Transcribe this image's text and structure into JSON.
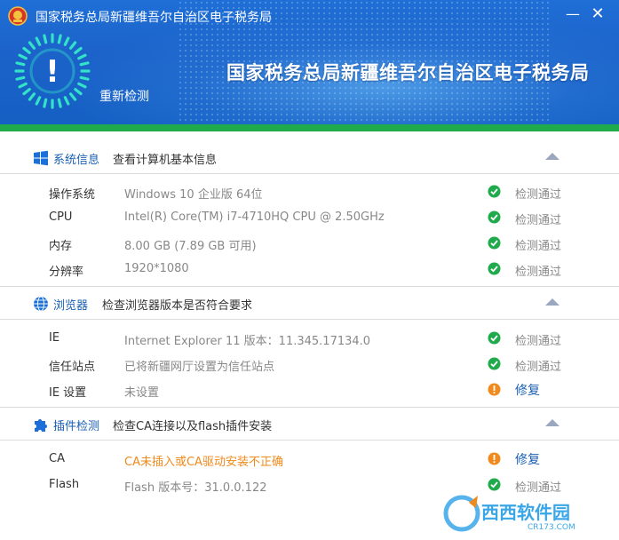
{
  "window": {
    "title": "国家税务总局新疆维吾尔自治区电子税务局",
    "minimize_glyph": "—",
    "close_glyph": "✕"
  },
  "banner": {
    "status_glyph": "!",
    "recheck_label": "重新检测",
    "title": "国家税务总局新疆维吾尔自治区电子税务局"
  },
  "sections": [
    {
      "icon": "windows-icon",
      "name": "系统信息",
      "desc": "查看计算机基本信息",
      "rows": [
        {
          "label": "操作系统",
          "value": "Windows 10 企业版 64位",
          "status": "pass",
          "status_text": "检测通过"
        },
        {
          "label": "CPU",
          "value": "Intel(R) Core(TM) i7-4710HQ CPU @ 2.50GHz",
          "status": "pass",
          "status_text": "检测通过"
        },
        {
          "label": "内存",
          "value": "8.00 GB (7.89 GB 可用)",
          "status": "pass",
          "status_text": "检测通过"
        },
        {
          "label": "分辨率",
          "value": "1920*1080",
          "status": "pass",
          "status_text": "检测通过"
        }
      ]
    },
    {
      "icon": "globe-icon",
      "name": "浏览器",
      "desc": "检查浏览器版本是否符合要求",
      "rows": [
        {
          "label": "IE",
          "value": "Internet Explorer 11   版本：11.345.17134.0",
          "status": "pass",
          "status_text": "检测通过"
        },
        {
          "label": "信任站点",
          "value": "已将新疆网厅设置为信任站点",
          "status": "pass",
          "status_text": "检测通过"
        },
        {
          "label": "IE 设置",
          "value": "未设置",
          "status": "warn",
          "status_text": "修复"
        }
      ]
    },
    {
      "icon": "puzzle-icon",
      "name": "插件检测",
      "desc": "检查CA连接以及flash插件安装",
      "rows": [
        {
          "label": "CA",
          "value": "CA未插入或CA驱动安装不正确",
          "status": "warn",
          "status_text": "修复"
        },
        {
          "label": "Flash",
          "value": "Flash 版本号：31.0.0.122",
          "status": "pass",
          "status_text": "检测通过"
        }
      ]
    }
  ],
  "watermark": {
    "brand": "西西软件园",
    "domain": "CR173.COM"
  },
  "colors": {
    "accent": "#1a5fb4",
    "pass": "#1faa4c",
    "warn": "#f08a1c",
    "banner": "#1b62c9"
  }
}
